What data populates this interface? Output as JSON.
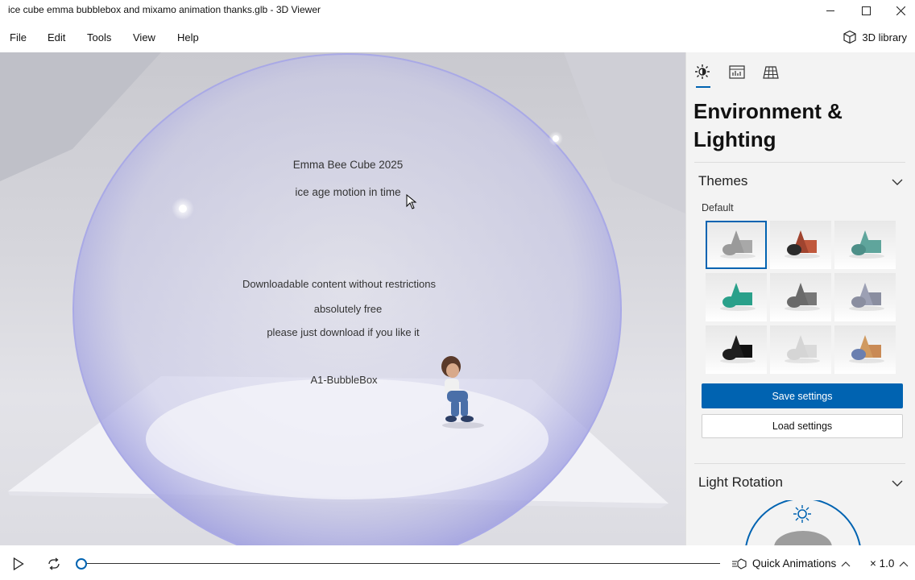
{
  "window": {
    "title": "ice cube emma bubblebox and mixamo animation thanks.glb - 3D Viewer",
    "minimize_icon": "minimize-icon",
    "maximize_icon": "maximize-icon",
    "close_icon": "close-icon"
  },
  "menu": {
    "items": [
      "File",
      "Edit",
      "Tools",
      "View",
      "Help"
    ],
    "library_label": "3D library",
    "library_icon": "cube-icon"
  },
  "viewport": {
    "lines": [
      "Emma Bee Cube 2025",
      "ice age motion in time",
      "Downloadable  content  without  restrictions",
      "absolutely free",
      "please just  download if  you like it",
      "A1-BubbleBox"
    ]
  },
  "panel": {
    "tabs": [
      "sun-icon",
      "stats-icon",
      "grid-icon"
    ],
    "heading_line1": "Environment &",
    "heading_line2": "Lighting",
    "themes_title": "Themes",
    "selected_theme_label": "Default",
    "themes": [
      {
        "shape_color": "#9a9a9a",
        "cone": "#9a9a9a",
        "box": "#a8a8a8",
        "bg": "#f0f0f0",
        "selected": true
      },
      {
        "shape_color": "#2b2b2b",
        "cone": "#a0442f",
        "box": "#c0583c",
        "bg": "#f0f0f0",
        "selected": false
      },
      {
        "shape_color": "#4d8f88",
        "cone": "#5fa59c",
        "box": "#5fa59c",
        "bg": "#f0f0f0",
        "selected": false
      },
      {
        "shape_color": "#2aa08a",
        "cone": "#2aa08a",
        "box": "#2aa08a",
        "bg": "#f0f0f0",
        "selected": false
      },
      {
        "shape_color": "#6a6a6a",
        "cone": "#6a6a6a",
        "box": "#777777",
        "bg": "#f0f0f0",
        "selected": false
      },
      {
        "shape_color": "#8a8ea0",
        "cone": "#9ca0b4",
        "box": "#8a8ea0",
        "bg": "#f0f0f0",
        "selected": false
      },
      {
        "shape_color": "#1e1e1e",
        "cone": "#1e1e1e",
        "box": "#111111",
        "bg": "#f0f0f0",
        "selected": false
      },
      {
        "shape_color": "#d5d5d5",
        "cone": "#d5d5d5",
        "box": "#dadada",
        "bg": "#f0f0f0",
        "selected": false
      },
      {
        "shape_color": "#6a7fb0",
        "cone": "#d09a60",
        "box": "#c98a55",
        "bg": "#f0f0f0",
        "selected": false
      }
    ],
    "save_label": "Save settings",
    "load_label": "Load settings",
    "light_rotation_title": "Light Rotation",
    "accent": "#0063b1"
  },
  "player": {
    "play_icon": "play-icon",
    "loop_icon": "loop-icon",
    "progress": 0.0,
    "quick_animations_label": "Quick Animations",
    "speed_label": "× 1.0"
  }
}
